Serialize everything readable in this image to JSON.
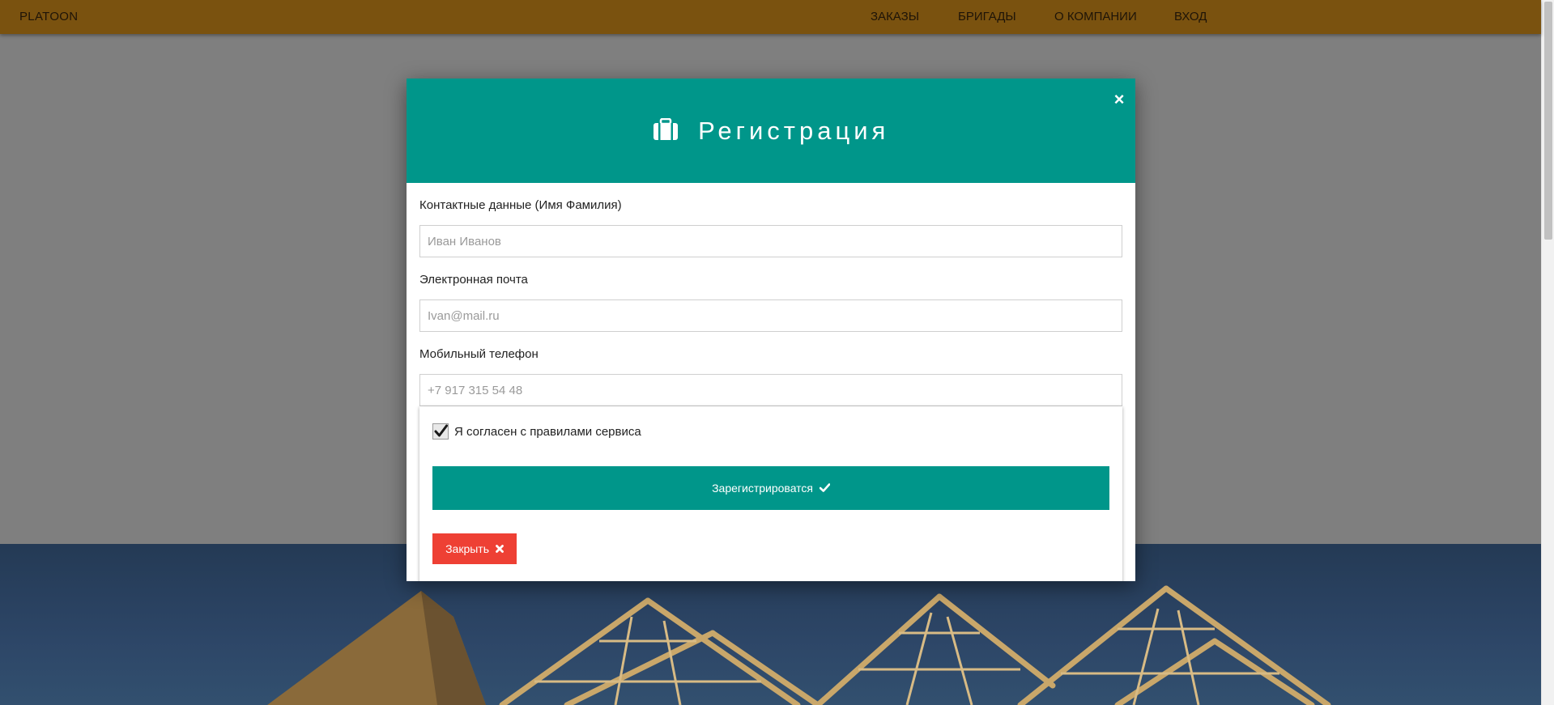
{
  "navbar": {
    "brand": "PLATOON",
    "links": [
      "ЗАКАЗЫ",
      "БРИГАДЫ",
      "О КОМПАНИИ",
      "ВХОД"
    ]
  },
  "modal": {
    "icon": "briefcase-icon",
    "title": "Регистрация",
    "close_glyph": "×",
    "fields": [
      {
        "label": "Контактные данные (Имя Фамилия)",
        "placeholder": "Иван Иванов",
        "value": ""
      },
      {
        "label": "Электронная почта",
        "placeholder": "Ivan@mail.ru",
        "value": ""
      },
      {
        "label": "Мобильный телефон",
        "placeholder": "+7 917 315 54 48",
        "value": ""
      }
    ],
    "agree": {
      "label": "Я согласен с правилами сервиса",
      "checked": true
    },
    "register_button": {
      "label": "Зарегистрироватся",
      "icon": "check-icon"
    },
    "close_button": {
      "label": "Закрыть",
      "icon": "times-icon"
    }
  },
  "colors": {
    "navbar": "#7a520f",
    "teal": "#00968a",
    "red": "#ee4034"
  }
}
